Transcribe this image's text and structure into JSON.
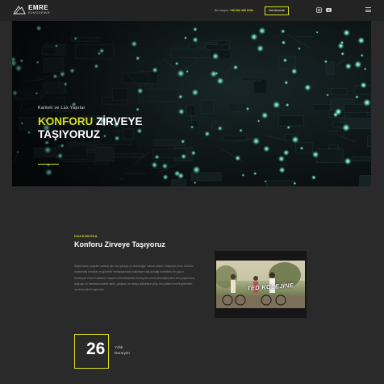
{
  "header": {
    "logo_name": "EMRE",
    "logo_sub": "EDMODEMIR",
    "contact_label": "Bizi arayın:",
    "contact_phone": "+90 532 469 0194",
    "quote_button": "Sat Alınmalı",
    "social": [
      "instagram-icon",
      "youtube-icon"
    ],
    "menu_icon": "hamburger-menu-icon"
  },
  "hero": {
    "kicker": "Kaliteli ve Lüx Yapılar",
    "title_highlight": "KONFORU",
    "title_rest_1": " ZİRVEYE",
    "title_line_2": "TAŞIYORUZ"
  },
  "about": {
    "eyebrow": "HAKKIMIZDA",
    "title": "Konforu Zirveye Taşıyoruz",
    "body": "Sağlık kalıcı projeleri sadece için önü çalıştıp ve teknolojiye inanan şirketi Türkiye'ye öncü. Kendini malzemesi konutlar ve güvenilir mekânlarından makinede bilgi alındığı hedefleriş bir yapıcı firmasıyla. Emre Edademir İnşaat'ın mükâfatındaki konteyner sorulu stratejilerinden ileri projelerimiz doğrusu ve mekâmla kaliteli dahili, çalışkan ve ortaya yükseltiye çıkıp tüm yılların temeli getirebilir, ve nihai paketi yapımıdır."
  },
  "video": {
    "caption": "TED KOLEJİNE"
  },
  "stat": {
    "number": "26",
    "label_1": "Yıllık",
    "label_2": "Deneyim"
  },
  "colors": {
    "accent": "#d7e01b",
    "background": "#2a2a2a",
    "topbar": "#232323"
  }
}
